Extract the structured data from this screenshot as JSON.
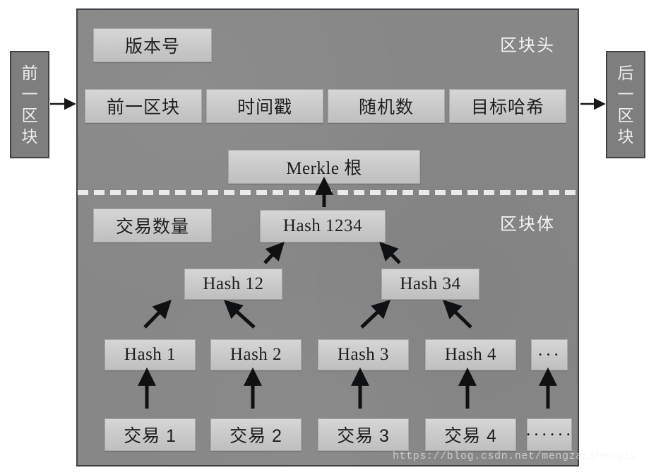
{
  "diagram": {
    "title": "Blockchain block structure with Merkle tree",
    "colors": {
      "block_background": "#878787",
      "field_fill": "#c9c9c9",
      "side_block_fill": "#7e7e7e",
      "border": "#3f4348",
      "caption_text": "#f1f3f4",
      "divider": "#e8eaec"
    }
  },
  "neighbors": {
    "previous": {
      "label": "前一区块"
    },
    "next": {
      "label": "后一区块"
    }
  },
  "block_header": {
    "caption": "区块头",
    "version": {
      "label": "版本号"
    },
    "fields": [
      {
        "label": "前一区块"
      },
      {
        "label": "时间戳"
      },
      {
        "label": "随机数"
      },
      {
        "label": "目标哈希"
      }
    ],
    "merkle_root": {
      "label": "Merkle 根"
    }
  },
  "block_body": {
    "caption": "区块体",
    "tx_count": {
      "label": "交易数量"
    },
    "merkle_tree": {
      "level_root": [
        {
          "label": "Hash 1234"
        }
      ],
      "level_mid": [
        {
          "label": "Hash 12"
        },
        {
          "label": "Hash 34"
        }
      ],
      "level_leaf": [
        {
          "label": "Hash 1"
        },
        {
          "label": "Hash 2"
        },
        {
          "label": "Hash 3"
        },
        {
          "label": "Hash 4"
        },
        {
          "label": "···"
        }
      ]
    },
    "transactions": [
      {
        "label": "交易 1"
      },
      {
        "label": "交易 2"
      },
      {
        "label": "交易 3"
      },
      {
        "label": "交易 4"
      },
      {
        "label": "······"
      }
    ]
  },
  "watermark": {
    "text": "https://blog.csdn.net/mengzaishenqiu"
  }
}
